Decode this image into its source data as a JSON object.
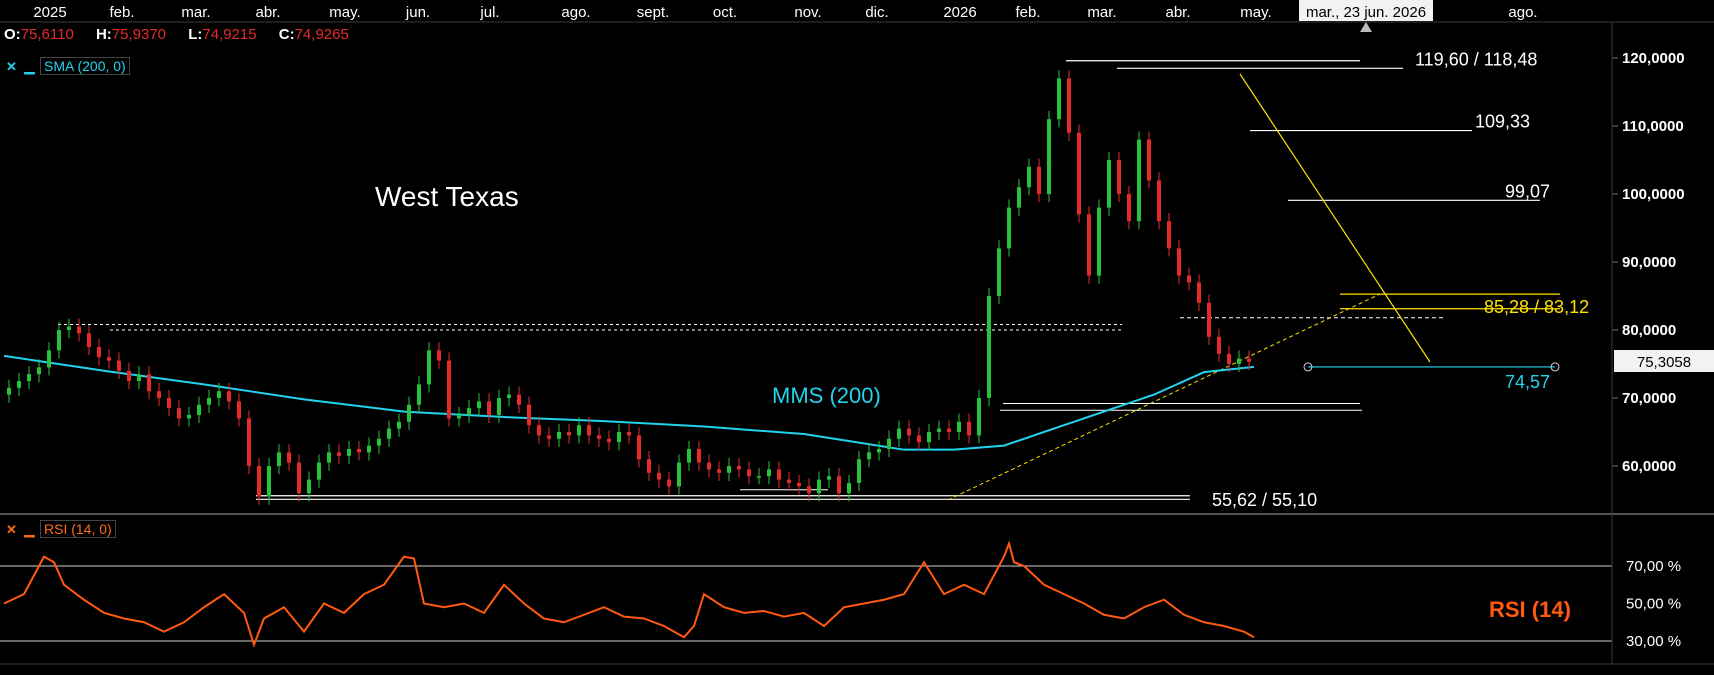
{
  "instrument": {
    "title": "West Texas"
  },
  "ohlc": {
    "open_label": "O:",
    "open": "75,6110",
    "high_label": "H:",
    "high": "75,9370",
    "low_label": "L:",
    "low": "74,9215",
    "close_label": "C:",
    "close": "74,9265"
  },
  "indicators": {
    "sma": {
      "label": "SMA (200, 0)",
      "close_icon": "✕",
      "minimize_icon": "▁",
      "color": "#22d3ee"
    },
    "rsi": {
      "label": "RSI (14, 0)",
      "close_icon": "✕",
      "minimize_icon": "▁",
      "color": "#ff6a1a"
    }
  },
  "crosshair": {
    "date_label": "mar., 23 jun. 2026"
  },
  "chart_data": [
    {
      "type": "line",
      "title": "West Texas",
      "x_ticks": [
        "2025",
        "feb.",
        "mar.",
        "abr.",
        "may.",
        "jun.",
        "jul.",
        "ago.",
        "sept.",
        "oct.",
        "nov.",
        "dic.",
        "2026",
        "feb.",
        "mar.",
        "abr.",
        "may.",
        "jun.",
        "ago."
      ],
      "y_ticks": [
        "60,0000",
        "70,0000",
        "80,0000",
        "90,0000",
        "100,0000",
        "110,0000",
        "120,0000"
      ],
      "ylim": [
        52,
        124
      ],
      "last_price": "75,3058",
      "price_x": [
        0,
        10,
        20,
        30,
        40,
        50,
        60,
        70,
        80,
        90,
        100,
        110,
        120,
        130,
        140,
        150,
        160,
        170,
        180,
        190,
        200,
        210,
        220,
        230,
        240,
        250,
        260,
        270,
        280,
        290,
        300,
        310,
        320,
        330,
        340,
        350,
        360,
        370,
        380,
        390,
        400,
        410,
        420,
        430,
        440,
        450,
        460,
        470,
        480,
        490,
        500,
        510,
        520,
        530,
        540,
        550,
        560,
        570,
        580,
        590,
        600,
        610,
        620,
        630,
        640,
        650,
        660,
        670,
        680,
        690,
        700,
        710,
        720,
        730,
        740,
        750,
        760,
        770,
        780,
        790,
        800,
        810,
        820,
        830,
        840,
        850,
        860,
        870,
        880,
        890,
        900,
        910,
        920,
        930,
        940,
        950,
        960,
        970,
        980,
        990,
        1000,
        1010,
        1020,
        1030,
        1040,
        1050,
        1060,
        1070,
        1080,
        1090,
        1100,
        1110,
        1120,
        1130,
        1140,
        1150,
        1160,
        1170,
        1180,
        1190,
        1200,
        1210,
        1220,
        1230,
        1240,
        1250
      ],
      "price_y": [
        70.5,
        71.5,
        72.5,
        73.5,
        74.5,
        77.0,
        80.0,
        80.5,
        79.5,
        77.5,
        76.0,
        75.5,
        74.0,
        72.5,
        73.5,
        71.0,
        70.0,
        68.5,
        67.0,
        67.5,
        69.0,
        70.0,
        71.0,
        69.5,
        67.0,
        60.0,
        55.5,
        60.0,
        62.0,
        60.5,
        56.0,
        58.0,
        60.5,
        62.0,
        61.5,
        62.5,
        62.0,
        63.0,
        64.0,
        65.5,
        66.5,
        69.0,
        72.0,
        77.0,
        75.5,
        67.0,
        67.5,
        68.5,
        69.5,
        67.5,
        70.0,
        70.5,
        69.0,
        66.0,
        64.5,
        64.0,
        65.0,
        64.5,
        66.0,
        64.5,
        64.0,
        63.5,
        65.0,
        64.5,
        61.0,
        59.0,
        58.0,
        57.0,
        60.5,
        62.5,
        60.5,
        59.5,
        59.0,
        60.0,
        59.5,
        58.5,
        58.5,
        59.5,
        58.0,
        57.5,
        57.0,
        56.0,
        58.0,
        58.5,
        56.0,
        57.5,
        61.0,
        62.0,
        62.5,
        64.0,
        65.5,
        64.5,
        63.5,
        65.0,
        65.5,
        65.0,
        66.5,
        64.5,
        70.0,
        85.0,
        92.0,
        98.0,
        101.0,
        104.0,
        100.0,
        111.0,
        117.0,
        109.0,
        97.0,
        88.0,
        98.0,
        105.0,
        100.0,
        96.0,
        108.0,
        102.0,
        96.0,
        92.0,
        88.0,
        87.0,
        84.0,
        79.0,
        76.5,
        75.0,
        75.8,
        75.3
      ],
      "sma_x": [
        0,
        100,
        200,
        300,
        400,
        500,
        600,
        700,
        800,
        900,
        950,
        1000,
        1050,
        1100,
        1150,
        1200,
        1250
      ],
      "sma_y": [
        76.2,
        74.0,
        72.0,
        69.8,
        68.0,
        67.2,
        66.6,
        65.8,
        64.7,
        62.4,
        62.4,
        63.0,
        65.5,
        68.0,
        70.5,
        73.8,
        74.57
      ],
      "levels": [
        {
          "label": "119,60 / 118,48",
          "values": [
            119.6,
            118.48
          ],
          "color": "#ffffff"
        },
        {
          "label": "109,33",
          "values": [
            109.33
          ],
          "color": "#ffffff"
        },
        {
          "label": "99,07",
          "values": [
            99.07
          ],
          "color": "#ffffff"
        },
        {
          "label": "85,28 / 83,12",
          "values": [
            85.28,
            83.12
          ],
          "color": "#ffe100"
        },
        {
          "label": "74,57",
          "values": [
            74.57
          ],
          "color": "#22d3ee"
        },
        {
          "label": "55,62 / 55,10",
          "values": [
            55.62,
            55.1
          ],
          "color": "#ffffff"
        }
      ],
      "annotations": [
        "MMS (200)"
      ]
    },
    {
      "type": "line",
      "title": "RSI (14)",
      "y_ticks": [
        "70,00 %",
        "50,00 %",
        "30,00 %"
      ],
      "ylim": [
        25,
        90
      ],
      "x": [
        0,
        20,
        40,
        50,
        60,
        80,
        100,
        120,
        140,
        160,
        180,
        200,
        220,
        240,
        250,
        260,
        280,
        300,
        320,
        340,
        360,
        380,
        400,
        410,
        420,
        440,
        460,
        480,
        500,
        520,
        540,
        560,
        580,
        600,
        620,
        640,
        660,
        680,
        690,
        700,
        720,
        740,
        760,
        780,
        800,
        820,
        840,
        860,
        880,
        900,
        920,
        940,
        960,
        980,
        1000,
        1005,
        1010,
        1020,
        1030,
        1040,
        1060,
        1080,
        1100,
        1120,
        1140,
        1160,
        1180,
        1200,
        1220,
        1240,
        1250
      ],
      "y": [
        50,
        55,
        75,
        72,
        60,
        52,
        45,
        42,
        40,
        35,
        40,
        48,
        55,
        45,
        28,
        42,
        48,
        35,
        50,
        45,
        55,
        60,
        75,
        74,
        50,
        48,
        50,
        45,
        60,
        50,
        42,
        40,
        44,
        48,
        43,
        42,
        38,
        32,
        38,
        55,
        48,
        45,
        46,
        43,
        45,
        38,
        48,
        50,
        52,
        55,
        72,
        55,
        60,
        55,
        75,
        82,
        72,
        70,
        65,
        60,
        55,
        50,
        44,
        42,
        48,
        52,
        44,
        40,
        38,
        35,
        32
      ],
      "levels": [
        70,
        30
      ],
      "label": "RSI (14)"
    }
  ]
}
